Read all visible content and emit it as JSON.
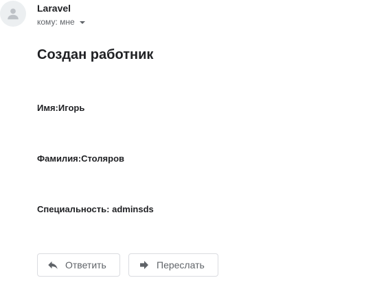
{
  "message": {
    "sender": "Laravel",
    "recipient": "кому: мне",
    "title": "Создан работник",
    "fields": {
      "name": "Имя:Игорь",
      "surname": "Фамилия:Столяров",
      "specialty": "Специальность: adminsds"
    }
  },
  "actions": {
    "reply_label": "Ответить",
    "forward_label": "Переслать"
  },
  "icons": {
    "avatar": "person-icon",
    "recipient_dropdown": "caret-down-icon",
    "reply": "reply-icon",
    "forward": "forward-icon"
  }
}
